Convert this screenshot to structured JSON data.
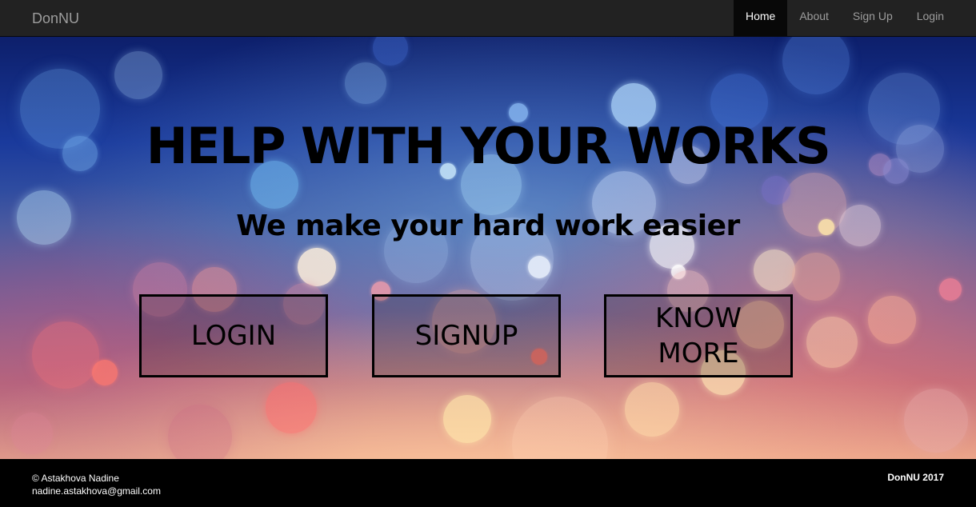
{
  "navbar": {
    "brand": "DonNU",
    "items": [
      {
        "label": "Home",
        "active": true
      },
      {
        "label": "About",
        "active": false
      },
      {
        "label": "Sign Up",
        "active": false
      },
      {
        "label": "Login",
        "active": false
      }
    ]
  },
  "hero": {
    "title": "HELP WITH YOUR WORKS",
    "subtitle": "We make your hard work easier",
    "buttons": {
      "login": "LOGIN",
      "signup": "SIGNUP",
      "know_more_line1": "KNOW",
      "know_more_line2": "MORE"
    }
  },
  "footer": {
    "copyright": "© Astakhova Nadine",
    "email": "nadine.astakhova@gmail.com",
    "right_text": "DonNU 2017"
  },
  "colors": {
    "navbar_bg": "#222222",
    "nav_active_bg": "#080808",
    "nav_text": "#9d9d9d",
    "footer_bg": "#000000"
  }
}
